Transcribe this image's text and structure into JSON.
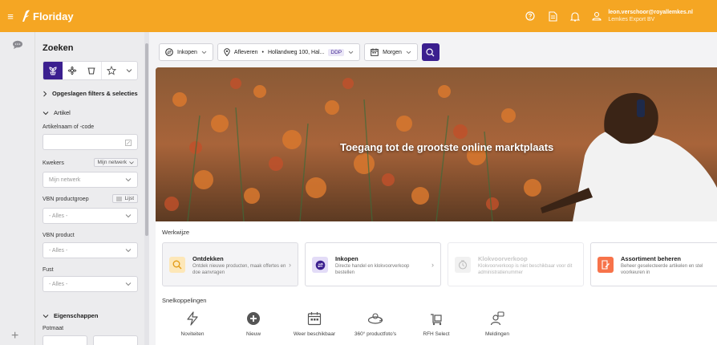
{
  "header": {
    "brand": "Floriday",
    "user_email": "leon.verschoor@royallemkes.nl",
    "user_company": "Lemkes Export BV",
    "accent": "#f5a623"
  },
  "sidebar": {
    "title": "Zoeken",
    "saved_filters": "Opgeslagen filters & selecties",
    "artikel_section": "Artikel",
    "article_label": "Artikelnaam of -code",
    "kwekers_label": "Kwekers",
    "kwekers_pill": "Mijn netwerk",
    "kwekers_value": "Mijn netwerk",
    "vbn_group_label": "VBN productgroep",
    "vbn_group_pill": "Lijst",
    "vbn_group_value": "- Alles -",
    "vbn_product_label": "VBN product",
    "vbn_product_value": "- Alles -",
    "fust_label": "Fust",
    "fust_value": "- Alles -",
    "eigenschappen_section": "Eigenschappen",
    "potmaat_label": "Potmaat"
  },
  "toolbar": {
    "mode": "Inkopen",
    "delivery_label": "Afleveren",
    "delivery_address": "Hollandweg 100, Hal...",
    "delivery_tag": "DDP",
    "date": "Morgen"
  },
  "hero": {
    "title": "Toegang tot de grootste online marktplaats"
  },
  "werkwijze": {
    "title": "Werkwijze",
    "items": [
      {
        "name": "Ontdekken",
        "desc": "Ontdek nieuwe producten, maak offertes en doe aanvragen",
        "color": "#fde7b8"
      },
      {
        "name": "Inkopen",
        "desc": "Directe handel en klokvoorverkoop bestellen",
        "color": "#e3dcf7"
      },
      {
        "name": "Klokvoorverkoop",
        "desc": "Klokvoorverkoop is niet beschikbaar voor dit administratienummer",
        "color": "#e6e6e6"
      },
      {
        "name": "Assortiment beheren",
        "desc": "Beheer geselecteerde artikelen en stel voorkeuren in",
        "color": "#f7734a"
      }
    ]
  },
  "snelkoppelingen": {
    "title": "Snelkoppelingen",
    "items": [
      {
        "label": "Noviteiten"
      },
      {
        "label": "Nieuw"
      },
      {
        "label": "Weer beschikbaar"
      },
      {
        "label": "360° productfoto's"
      },
      {
        "label": "RFH Select"
      },
      {
        "label": "Meldingen"
      }
    ]
  }
}
